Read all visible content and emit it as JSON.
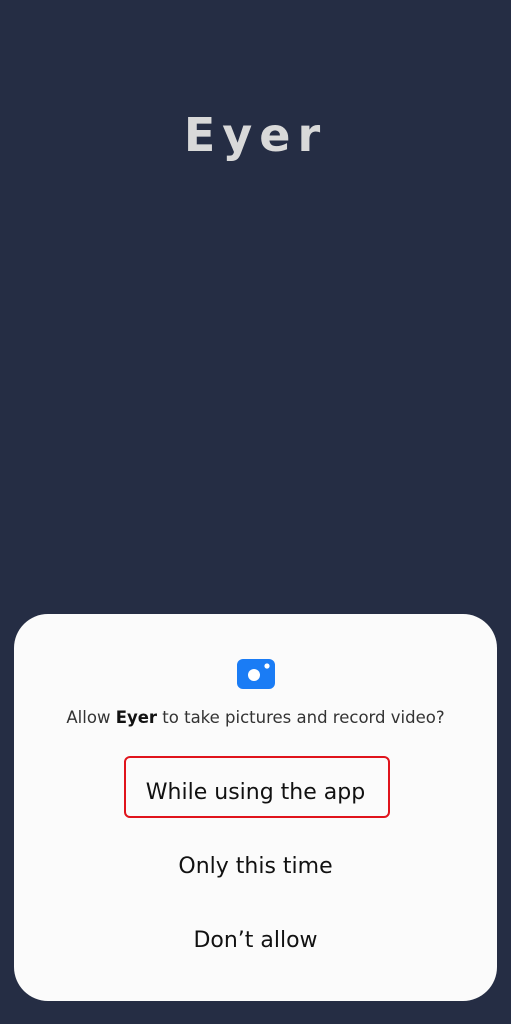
{
  "app": {
    "logo_text": "Eyer"
  },
  "dialog": {
    "icon": "camera-icon",
    "accent_color": "#1a7cf5",
    "prompt_prefix": "Allow ",
    "prompt_app_name": "Eyer",
    "prompt_suffix": " to take pictures and record video?",
    "options": [
      {
        "label": "While using the app",
        "highlighted": true
      },
      {
        "label": "Only this time"
      },
      {
        "label": "Don’t allow"
      }
    ],
    "highlight_color": "#e0141c"
  }
}
